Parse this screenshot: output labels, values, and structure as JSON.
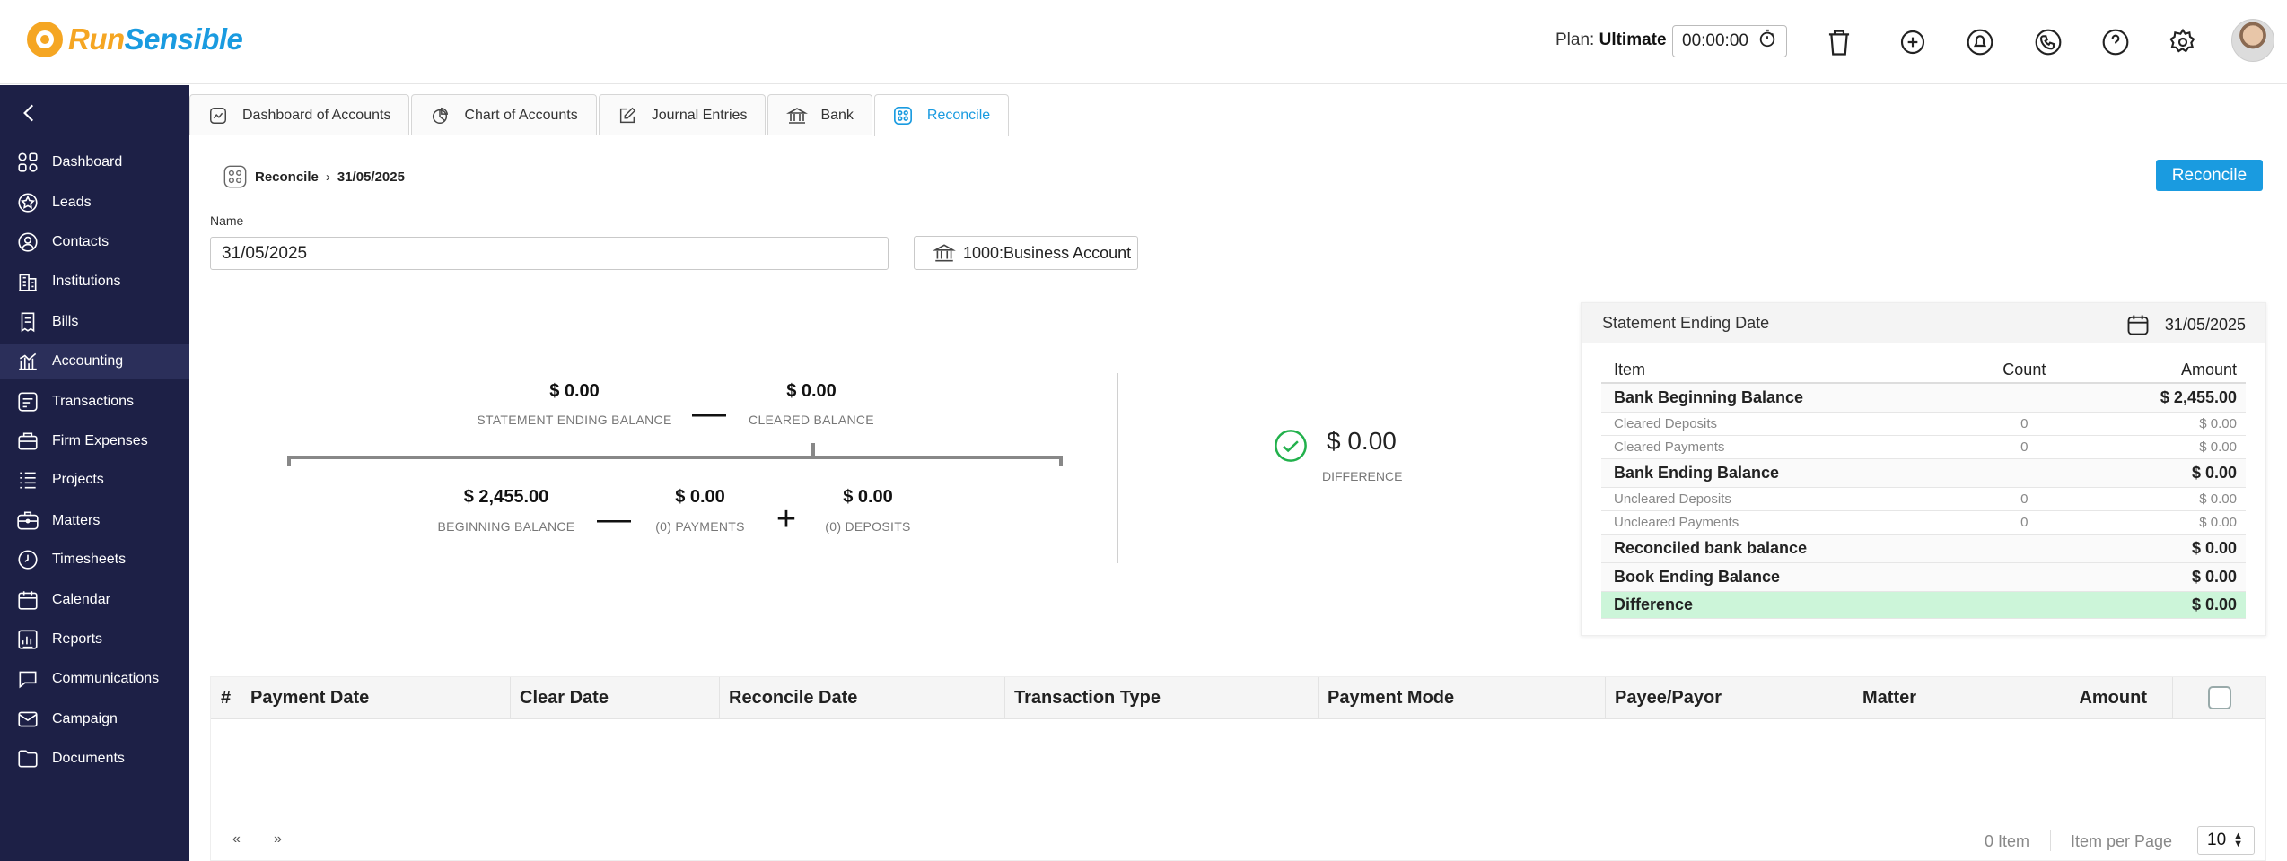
{
  "app": {
    "logo_run": "Run",
    "logo_sensible": "Sensible"
  },
  "topbar": {
    "plan_label": "Plan:",
    "plan_value": "Ultimate",
    "timer": "00:00:00",
    "icons": [
      "stopwatch-icon",
      "trash-icon",
      "add-time-icon",
      "notification-bell-icon",
      "phone-icon",
      "help-icon",
      "gear-icon",
      "avatar"
    ]
  },
  "sidebar": {
    "items": [
      {
        "label": "Dashboard",
        "icon": "dashboard-icon"
      },
      {
        "label": "Leads",
        "icon": "leads-icon"
      },
      {
        "label": "Contacts",
        "icon": "contacts-icon"
      },
      {
        "label": "Institutions",
        "icon": "institutions-icon"
      },
      {
        "label": "Bills",
        "icon": "bills-icon"
      },
      {
        "label": "Accounting",
        "icon": "accounting-icon",
        "active": true
      },
      {
        "label": "Transactions",
        "icon": "transactions-icon"
      },
      {
        "label": "Firm Expenses",
        "icon": "firm-expenses-icon"
      },
      {
        "label": "Projects",
        "icon": "projects-icon"
      },
      {
        "label": "Matters",
        "icon": "matters-icon"
      },
      {
        "label": "Timesheets",
        "icon": "timesheets-icon"
      },
      {
        "label": "Calendar",
        "icon": "calendar-icon"
      },
      {
        "label": "Reports",
        "icon": "reports-icon"
      },
      {
        "label": "Communications",
        "icon": "communications-icon"
      },
      {
        "label": "Campaign",
        "icon": "campaign-icon"
      },
      {
        "label": "Documents",
        "icon": "documents-icon"
      }
    ]
  },
  "tabs": [
    {
      "label": "Dashboard of Accounts"
    },
    {
      "label": "Chart of Accounts"
    },
    {
      "label": "Journal Entries"
    },
    {
      "label": "Bank"
    },
    {
      "label": "Reconcile",
      "active": true
    }
  ],
  "breadcrumb": {
    "root": "Reconcile",
    "current": "31/05/2025"
  },
  "actions": {
    "reconcile_button": "Reconcile"
  },
  "form": {
    "name_label": "Name",
    "name_value": "31/05/2025",
    "account": "1000:Business Account"
  },
  "formula": {
    "statement_ending_balance": {
      "value": "$ 0.00",
      "label": "STATEMENT ENDING BALANCE"
    },
    "cleared_balance": {
      "value": "$ 0.00",
      "label": "CLEARED BALANCE"
    },
    "beginning_balance": {
      "value": "$ 2,455.00",
      "label": "BEGINNING BALANCE"
    },
    "payments": {
      "value": "$ 0.00",
      "label": "(0) PAYMENTS"
    },
    "deposits": {
      "value": "$ 0.00",
      "label": "(0) DEPOSITS"
    },
    "difference": {
      "value": "$ 0.00",
      "label": "DIFFERENCE"
    }
  },
  "summary": {
    "title": "Statement Ending Date",
    "date": "31/05/2025",
    "headers": {
      "item": "Item",
      "count": "Count",
      "amount": "Amount"
    },
    "rows": [
      {
        "item": "Bank Beginning Balance",
        "count": "",
        "amount": "$ 2,455.00",
        "kind": "major"
      },
      {
        "item": "Cleared Deposits",
        "count": "0",
        "amount": "$ 0.00",
        "kind": "minor"
      },
      {
        "item": "Cleared Payments",
        "count": "0",
        "amount": "$ 0.00",
        "kind": "minor"
      },
      {
        "item": "Bank Ending Balance",
        "count": "",
        "amount": "$ 0.00",
        "kind": "major"
      },
      {
        "item": "Uncleared Deposits",
        "count": "0",
        "amount": "$ 0.00",
        "kind": "minor"
      },
      {
        "item": "Uncleared Payments",
        "count": "0",
        "amount": "$ 0.00",
        "kind": "minor"
      },
      {
        "item": "Reconciled bank balance",
        "count": "",
        "amount": "$ 0.00",
        "kind": "major"
      },
      {
        "item": "Book Ending Balance",
        "count": "",
        "amount": "$ 0.00",
        "kind": "major"
      },
      {
        "item": "Difference",
        "count": "",
        "amount": "$ 0.00",
        "kind": "diff"
      }
    ]
  },
  "grid": {
    "columns": [
      "#",
      "Payment Date",
      "Clear Date",
      "Reconcile Date",
      "Transaction Type",
      "Payment Mode",
      "Payee/Payor",
      "Matter",
      "Amount"
    ],
    "prev": "«",
    "next": "»",
    "items_count": "0 Item",
    "items_per_page_label": "Item per Page",
    "items_per_page": "10"
  },
  "colors": {
    "accent": "#1a9be0",
    "sidebar": "#1d2046",
    "success": "#22b14c",
    "diff_row": "#ccf5d9"
  }
}
